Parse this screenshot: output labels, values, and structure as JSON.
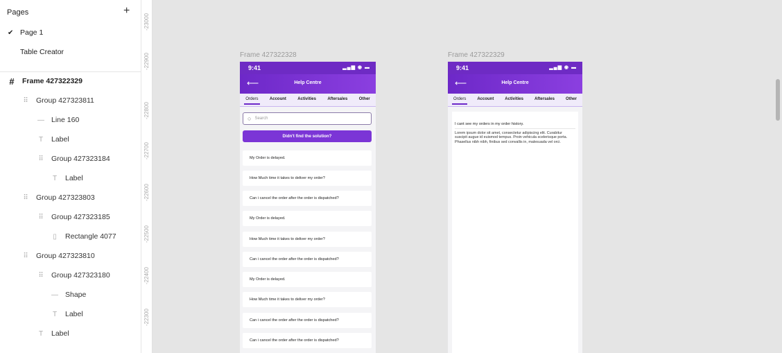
{
  "pages_panel": {
    "title": "Pages",
    "add_icon": "plus-icon",
    "pages": [
      {
        "label": "Page 1",
        "selected": true
      },
      {
        "label": "Table Creator",
        "selected": false
      }
    ]
  },
  "layers": [
    {
      "label": "Frame 427322329",
      "icon": "#",
      "type": "frame"
    },
    {
      "label": "Group 427323811",
      "icon": "⠿",
      "type": "group"
    },
    {
      "label": "Line 160",
      "icon": "—",
      "type": "line"
    },
    {
      "label": "Label",
      "icon": "T",
      "type": "text"
    },
    {
      "label": "Group 427323184",
      "icon": "⠿",
      "type": "group"
    },
    {
      "label": "Label",
      "icon": "T",
      "type": "text"
    },
    {
      "label": "Group 427323803",
      "icon": "⠿",
      "type": "group"
    },
    {
      "label": "Group 427323185",
      "icon": "⠿",
      "type": "group"
    },
    {
      "label": "Rectangle 4077",
      "icon": "▯",
      "type": "rect"
    },
    {
      "label": "Group 427323810",
      "icon": "⠿",
      "type": "group"
    },
    {
      "label": "Group 427323180",
      "icon": "⠿",
      "type": "group"
    },
    {
      "label": "Shape",
      "icon": "—",
      "type": "line"
    },
    {
      "label": "Label",
      "icon": "T",
      "type": "text"
    },
    {
      "label": "Label",
      "icon": "T",
      "type": "text"
    }
  ],
  "ruler_ticks": [
    "-23000",
    "-22900",
    "-22800",
    "-22700",
    "-22600",
    "-22500",
    "-22400",
    "-22300"
  ],
  "frames": [
    {
      "title": "Frame 427322328",
      "status_time": "9:41",
      "appbar_title": "Help Centre",
      "tabs": [
        "Orders",
        "Account",
        "Activities",
        "Aftersales",
        "Other"
      ],
      "search_placeholder": "Search",
      "cta_label": "Didn't find the solution?",
      "faqs": [
        "My Order is delayed.",
        "How Much time it takes to deliver my order?",
        "Can i cancel the order after the order is dispatched?",
        "My Order is delayed.",
        "How Much time it takes to deliver my order?",
        "Can i cancel the order after the order is dispatched?",
        "My Order is delayed.",
        "How Much time it takes to deliver my order?",
        "Can i cancel the order after the order is dispatched?",
        "Can i cancel the order after the order is dispatched?"
      ]
    },
    {
      "title": "Frame 427322329",
      "status_time": "9:41",
      "appbar_title": "Help Centre",
      "tabs": [
        "Orders",
        "Account",
        "Activities",
        "Aftersales",
        "Other"
      ],
      "answer_question": "I cant see my orders in my order history.",
      "answer_text": "Lorem ipsum dolor sit amet, consectetur adipiscing elit. Curabitur suscipit augue id euismod tempus. Proin vehicula scelerisque porta. Phasellus nibh nibh, finibus sed convallis in, malesuada vel orci."
    }
  ],
  "colors": {
    "accent": "#6e2bc4",
    "tab_bg": "#f0ebfa",
    "canvas": "#e5e5e5"
  }
}
